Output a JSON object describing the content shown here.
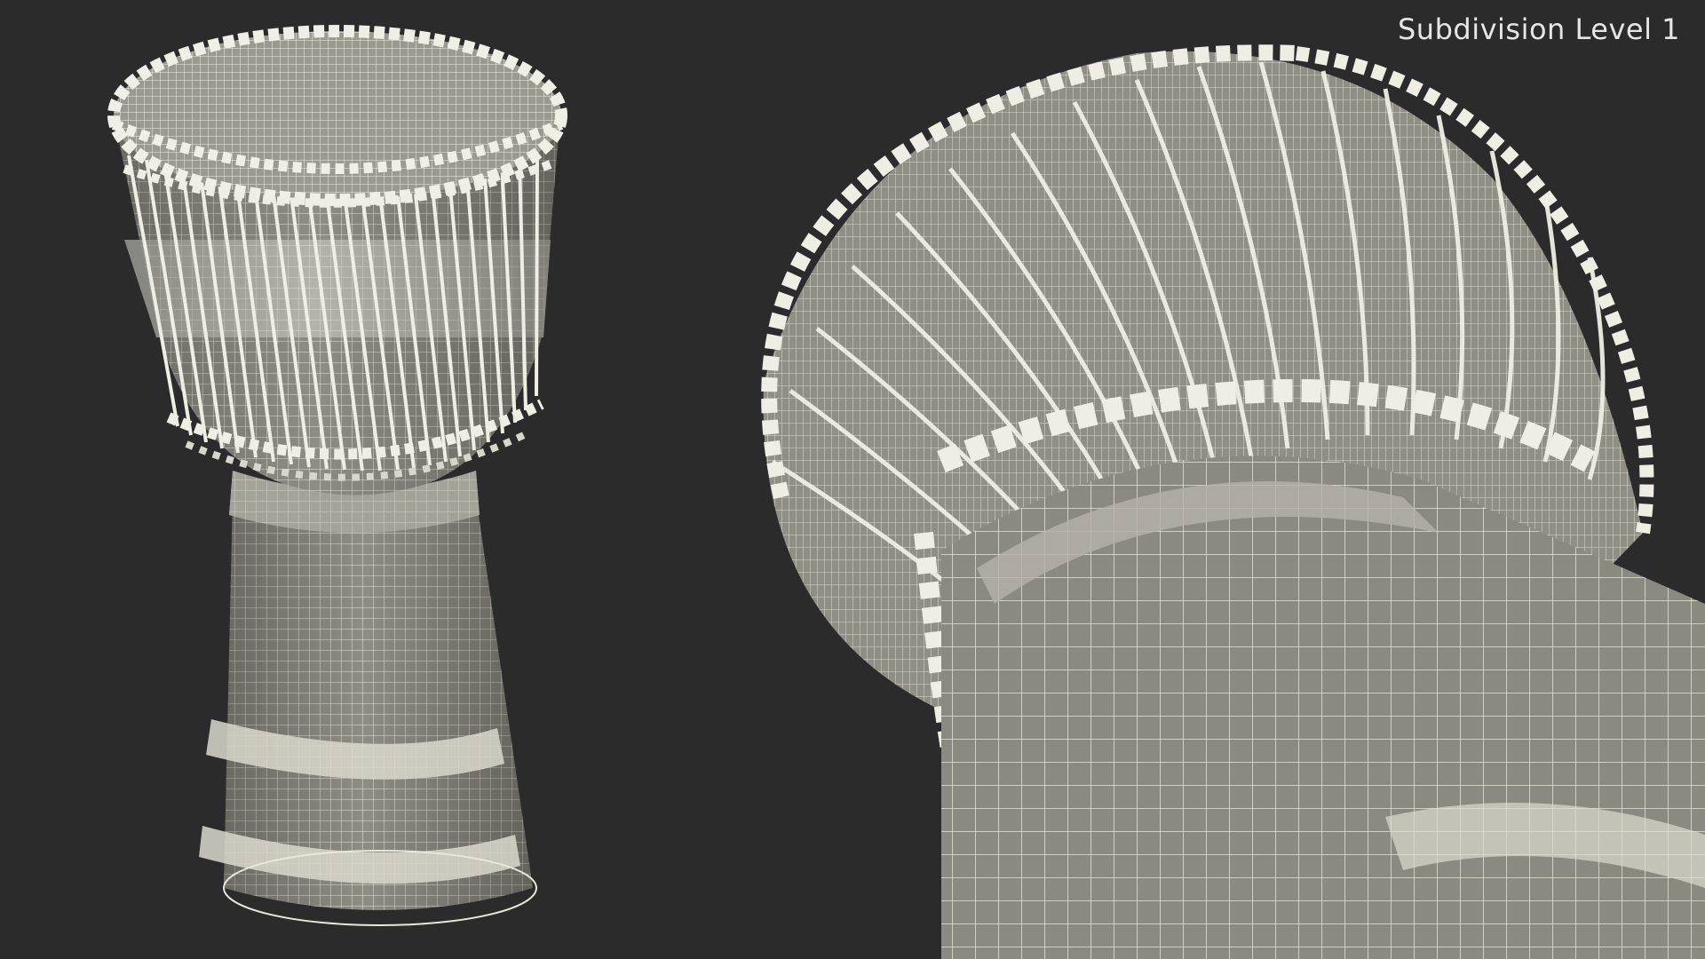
{
  "overlay": {
    "subdivision_label": "Subdivision Level 1"
  },
  "colors": {
    "background": "#2b2b2b",
    "mesh_surface": "#8a8a80",
    "mesh_light": "#d8d7cc",
    "wire": "#efeee4",
    "label_text": "#e6e6e6"
  },
  "views": [
    {
      "name": "front-three-quarter",
      "subject": "djembe-drum"
    },
    {
      "name": "close-up-bottom",
      "subject": "djembe-drum"
    }
  ]
}
